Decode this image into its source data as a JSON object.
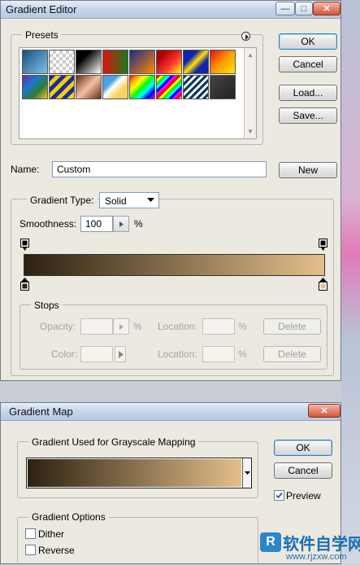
{
  "gradient_editor": {
    "title": "Gradient Editor",
    "presets_label": "Presets",
    "ok_label": "OK",
    "cancel_label": "Cancel",
    "load_label": "Load...",
    "save_label": "Save...",
    "name_label": "Name:",
    "name_value": "Custom",
    "new_label": "New",
    "gradient_type_label": "Gradient Type:",
    "gradient_type_value": "Solid",
    "smoothness_label": "Smoothness:",
    "smoothness_value": "100",
    "percent_sign": "%",
    "gradient_start_color": "#2d2111",
    "gradient_end_color": "#e3bf8a",
    "stops_label": "Stops",
    "opacity_label": "Opacity:",
    "color_label": "Color:",
    "location_label": "Location:",
    "delete_label": "Delete"
  },
  "gradient_map": {
    "title": "Gradient Map",
    "mapping_label": "Gradient Used for Grayscale Mapping",
    "ok_label": "OK",
    "cancel_label": "Cancel",
    "preview_label": "Preview",
    "preview_checked": true,
    "options_label": "Gradient Options",
    "dither_label": "Dither",
    "reverse_label": "Reverse"
  },
  "watermark": {
    "text": "软件自学网",
    "url": "www.rjzxw.com"
  }
}
